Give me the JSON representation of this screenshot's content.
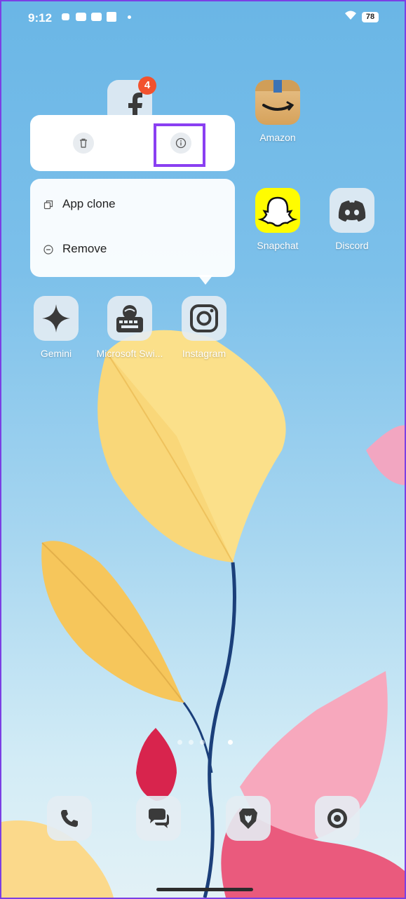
{
  "status_bar": {
    "time": "9:12",
    "battery": "78",
    "notification_icons": [
      "media-icon",
      "youtube-icon",
      "youtube-icon",
      "app-icon"
    ]
  },
  "home": {
    "apps": [
      {
        "name": "Amazon",
        "badge": null
      },
      {
        "name": "Snapchat",
        "badge": null
      },
      {
        "name": "Discord",
        "badge": null
      },
      {
        "name": "Gemini",
        "badge": null
      },
      {
        "name": "Microsoft Swi...",
        "badge": null
      },
      {
        "name": "Instagram",
        "badge": null
      }
    ],
    "facebook_badge": "4",
    "page_count": 4,
    "active_page": 4
  },
  "context_menu": {
    "shortcuts": [
      "trash-icon",
      "info-icon"
    ],
    "items": [
      {
        "label": "App clone",
        "icon": "clone-icon"
      },
      {
        "label": "Remove",
        "icon": "remove-icon"
      }
    ]
  },
  "dock": {
    "apps": [
      "phone-icon",
      "messages-icon",
      "brave-icon",
      "camera-icon"
    ]
  },
  "colors": {
    "highlight": "#8a3ff2",
    "badge": "#f2522e",
    "amazon": "#d9a961",
    "snapchat": "#fffc00"
  }
}
